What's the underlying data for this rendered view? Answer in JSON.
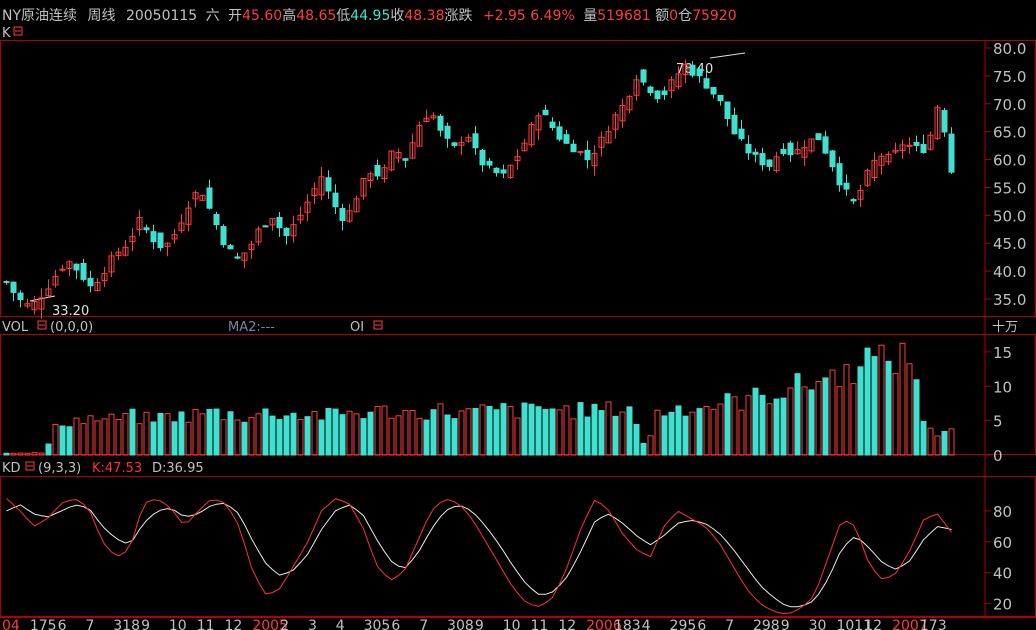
{
  "header": {
    "symbol": "NY原油连续",
    "period": "周线",
    "date": "20050115",
    "weekday": "六",
    "open_label": "开",
    "open": "45.60",
    "high_label": "高",
    "high": "48.65",
    "low_label": "低",
    "low": "44.95",
    "close_label": "收",
    "close": "48.38",
    "change_label": "涨跌",
    "change": "+2.95",
    "change_pct": "6.49%",
    "volume_label": "量",
    "volume": "519681",
    "amount_label": "额",
    "amount": "0",
    "oi_label": "仓",
    "oi": "75920"
  },
  "panels": {
    "price": {
      "label": "K",
      "icon": "panel-toggle-icon",
      "max_label": "78.40",
      "min_label": "33.20"
    },
    "volume": {
      "label": "VOL",
      "params": "(0,0,0)",
      "ma2": "MA2:---",
      "oi": "OI",
      "unit": "十万"
    },
    "kd": {
      "label": "KD",
      "params": "(9,3,3)",
      "k": "K:47.53",
      "d": "D:36.95"
    }
  },
  "colors": {
    "up": "#ff3c3c",
    "down": "#40e0d0",
    "k_line": "#ff3030",
    "d_line": "#e8e8e8",
    "frame": "#b00000",
    "grid": "#6e0000"
  },
  "x_ticks": [
    {
      "label": "04",
      "red": true
    },
    {
      "label": "175"
    },
    {
      "label": "6"
    },
    {
      "label": "7"
    },
    {
      "label": "318"
    },
    {
      "label": "9"
    },
    {
      "label": "10"
    },
    {
      "label": "11"
    },
    {
      "label": "12"
    },
    {
      "label": "2005",
      "red": true
    },
    {
      "label": "2"
    },
    {
      "label": "3"
    },
    {
      "label": "4"
    },
    {
      "label": "305"
    },
    {
      "label": "6"
    },
    {
      "label": "7"
    },
    {
      "label": "308"
    },
    {
      "label": "9"
    },
    {
      "label": "10"
    },
    {
      "label": "11"
    },
    {
      "label": "12"
    },
    {
      "label": "2006",
      "red": true
    },
    {
      "label": "183"
    },
    {
      "label": "4"
    },
    {
      "label": "295"
    },
    {
      "label": "6"
    },
    {
      "label": "7"
    },
    {
      "label": "298"
    },
    {
      "label": "9"
    },
    {
      "label": "30"
    },
    {
      "label": "1011"
    },
    {
      "label": "12"
    },
    {
      "label": "2007",
      "red": true
    },
    {
      "label": "173"
    }
  ],
  "chart_data": {
    "type": "candlestick",
    "title": "NY原油连续 周线",
    "price_axis": {
      "ticks": [
        "80.0",
        "75.0",
        "70.0",
        "65.0",
        "60.0",
        "55.0",
        "50.0",
        "45.0",
        "40.0",
        "35.0"
      ],
      "ylim": [
        32.5,
        81.0
      ]
    },
    "volume_axis": {
      "ticks": [
        "15",
        "10",
        "5",
        "0"
      ],
      "unit": "十万",
      "ylim": [
        0,
        16
      ]
    },
    "kd_axis": {
      "ticks": [
        "80",
        "60",
        "40",
        "20"
      ],
      "ylim": [
        12,
        100
      ]
    },
    "price_close_path": [
      38,
      35,
      33.5,
      36,
      39,
      42,
      40,
      37,
      40,
      43,
      45,
      49,
      46,
      44,
      47,
      52,
      55,
      50,
      45,
      42,
      44,
      48,
      50,
      46,
      49,
      53,
      57,
      52,
      49,
      54,
      58,
      57,
      62,
      60,
      66,
      69,
      64,
      62,
      65,
      60,
      58,
      57,
      60,
      64,
      69,
      66,
      63,
      62,
      60,
      63,
      67,
      70,
      75,
      73,
      71,
      74,
      77,
      75,
      73,
      70,
      65,
      62,
      60,
      59,
      62,
      61,
      63,
      64,
      60,
      55,
      52,
      57,
      61,
      60,
      63,
      62,
      62,
      71,
      58
    ],
    "volume_path": [
      0.3,
      0.3,
      0.3,
      0.3,
      4.5,
      5,
      5.2,
      5.3,
      5,
      5.5,
      5.6,
      5.2,
      5.4,
      5.8,
      5.5,
      6,
      6.2,
      6,
      5.8,
      5.5,
      6,
      6.2,
      5.9,
      5.8,
      6,
      5.6,
      6,
      6.2,
      6.1,
      6.3,
      6.4,
      6.2,
      6,
      6.3,
      6.5,
      6.2,
      6,
      6.4,
      6.3,
      6.6,
      6.4,
      6.5,
      6.8,
      6.7,
      6.5,
      6.4,
      6.6,
      6.5,
      6.8,
      6.9,
      0.8,
      6.2,
      6.5,
      7,
      6.8,
      7.2,
      7.5,
      7.8,
      8,
      8.5,
      9,
      9.5,
      10,
      10.5,
      11,
      12,
      11.5,
      15.5,
      13,
      14,
      14.2,
      13.8,
      3.5,
      3.2,
      4.2
    ],
    "k_path": [
      88,
      80,
      70,
      75,
      85,
      88,
      82,
      60,
      50,
      55,
      85,
      88,
      82,
      70,
      80,
      88,
      85,
      70,
      40,
      25,
      30,
      45,
      60,
      80,
      88,
      85,
      70,
      45,
      35,
      40,
      60,
      80,
      88,
      85,
      75,
      60,
      45,
      30,
      20,
      18,
      25,
      45,
      70,
      88,
      80,
      65,
      55,
      50,
      70,
      80,
      75,
      70,
      60,
      45,
      30,
      20,
      15,
      13,
      17,
      25,
      50,
      75,
      70,
      45,
      35,
      40,
      55,
      75,
      78,
      66
    ],
    "d_path": [
      80,
      84,
      78,
      76,
      80,
      84,
      82,
      70,
      62,
      58,
      72,
      80,
      82,
      76,
      78,
      84,
      85,
      78,
      60,
      45,
      38,
      42,
      52,
      68,
      80,
      84,
      78,
      62,
      48,
      42,
      52,
      68,
      80,
      84,
      80,
      70,
      58,
      44,
      32,
      25,
      28,
      38,
      55,
      74,
      78,
      72,
      64,
      58,
      64,
      72,
      74,
      72,
      66,
      56,
      44,
      32,
      24,
      18,
      18,
      22,
      36,
      56,
      64,
      56,
      46,
      42,
      48,
      62,
      70,
      68
    ]
  }
}
